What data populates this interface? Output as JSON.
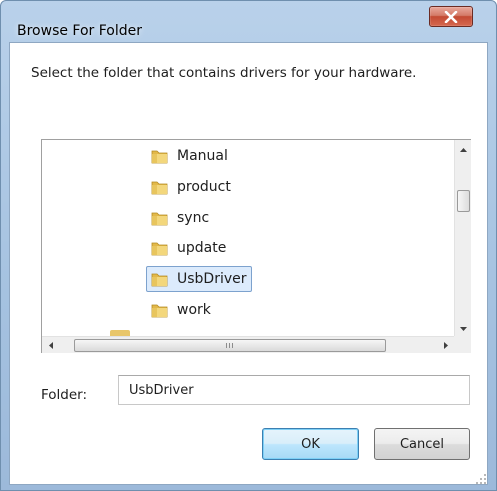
{
  "window": {
    "title": "Browse For Folder",
    "close_icon": "close-x-icon"
  },
  "prompt": "Select the folder that contains drivers for your hardware.",
  "tree": {
    "items": [
      {
        "label": "Manual",
        "icon": "folder-icon",
        "selected": false
      },
      {
        "label": "product",
        "icon": "folder-icon",
        "selected": false
      },
      {
        "label": "sync",
        "icon": "folder-icon",
        "selected": false
      },
      {
        "label": "update",
        "icon": "folder-icon",
        "selected": false
      },
      {
        "label": "UsbDriver",
        "icon": "folder-icon",
        "selected": true
      },
      {
        "label": "work",
        "icon": "folder-icon",
        "selected": false
      }
    ]
  },
  "folder_field": {
    "label": "Folder:",
    "value": "UsbDriver"
  },
  "buttons": {
    "ok": "OK",
    "cancel": "Cancel"
  },
  "colors": {
    "selection_bg": "#dcebfc",
    "selection_border": "#7da2ce",
    "close_button": "#c34a33",
    "titlebar": "#b9d1ea"
  }
}
